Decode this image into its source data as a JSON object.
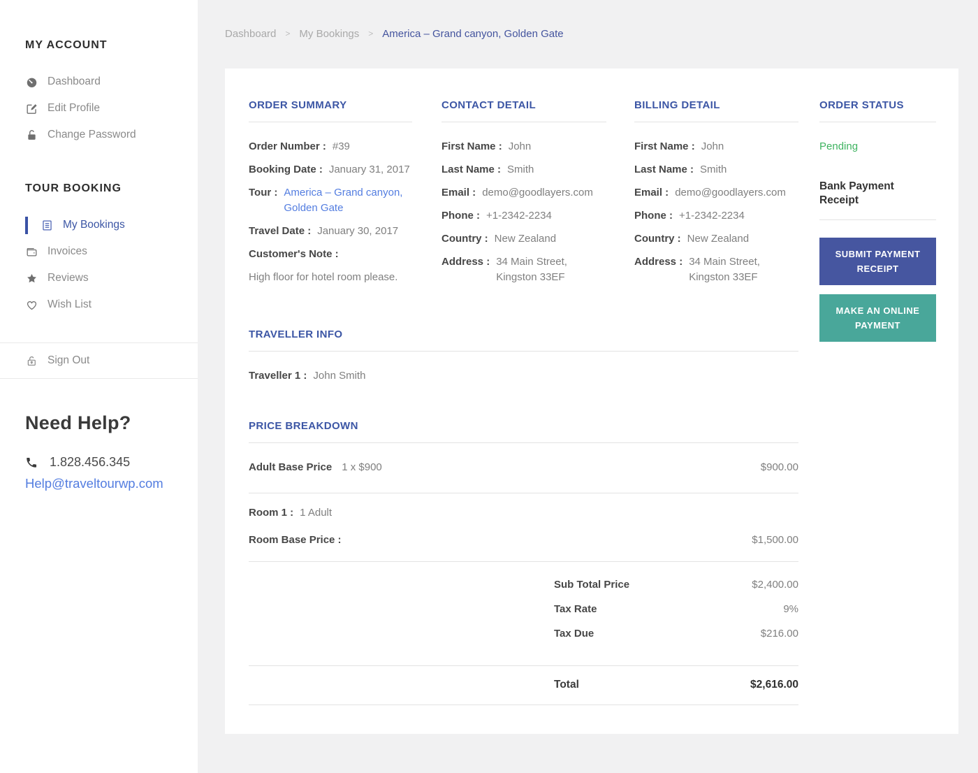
{
  "colors": {
    "heading_blue": "#3c56a5",
    "link_blue": "#537de0",
    "pending_green": "#3eb360",
    "button_blue": "#4656a0",
    "button_teal": "#49a79a",
    "background": "#f1f1f2"
  },
  "sidebar": {
    "account": {
      "title": "MY ACCOUNT",
      "items": [
        {
          "label": "Dashboard",
          "icon": "dashboard-icon"
        },
        {
          "label": "Edit Profile",
          "icon": "edit-icon"
        },
        {
          "label": "Change Password",
          "icon": "lock-icon"
        }
      ]
    },
    "booking": {
      "title": "TOUR BOOKING",
      "items": [
        {
          "label": "My Bookings",
          "icon": "bookings-icon",
          "active": true
        },
        {
          "label": "Invoices",
          "icon": "wallet-icon"
        },
        {
          "label": "Reviews",
          "icon": "star-icon"
        },
        {
          "label": "Wish List",
          "icon": "heart-icon"
        }
      ]
    },
    "signout": {
      "label": "Sign Out",
      "icon": "padlock-icon"
    },
    "help": {
      "title": "Need Help?",
      "phone": "1.828.456.345",
      "email": "Help@traveltourwp.com"
    }
  },
  "breadcrumb": {
    "sep": ">",
    "items": [
      {
        "label": "Dashboard"
      },
      {
        "label": "My Bookings"
      },
      {
        "label": "America – Grand canyon, Golden Gate"
      }
    ]
  },
  "order_summary": {
    "title": "ORDER SUMMARY",
    "rows": [
      {
        "label": "Order Number :",
        "value": "#39"
      },
      {
        "label": "Booking Date :",
        "value": "January 31, 2017"
      },
      {
        "label": "Tour :",
        "value": "America – Grand canyon, Golden Gate"
      },
      {
        "label": "Travel Date :",
        "value": "January 30, 2017"
      }
    ],
    "note_label": "Customer's Note :",
    "note": "High floor for hotel room please."
  },
  "contact_detail": {
    "title": "CONTACT DETAIL",
    "rows": [
      {
        "label": "First Name :",
        "value": "John"
      },
      {
        "label": "Last Name :",
        "value": "Smith"
      },
      {
        "label": "Email :",
        "value": "demo@goodlayers.com"
      },
      {
        "label": "Phone :",
        "value": "+1-2342-2234"
      },
      {
        "label": "Country :",
        "value": "New Zealand"
      },
      {
        "label": "Address :",
        "value": "34 Main Street, Kingston 33EF"
      }
    ]
  },
  "billing_detail": {
    "title": "BILLING DETAIL",
    "rows": [
      {
        "label": "First Name :",
        "value": "John"
      },
      {
        "label": "Last Name :",
        "value": "Smith"
      },
      {
        "label": "Email :",
        "value": "demo@goodlayers.com"
      },
      {
        "label": "Phone :",
        "value": "+1-2342-2234"
      },
      {
        "label": "Country :",
        "value": "New Zealand"
      },
      {
        "label": "Address :",
        "value": "34 Main Street, Kingston 33EF"
      }
    ]
  },
  "order_status": {
    "title": "ORDER STATUS",
    "status": "Pending",
    "receipt_label": "Bank Payment Receipt",
    "buttons": [
      {
        "label": "SUBMIT PAYMENT RECEIPT"
      },
      {
        "label": "MAKE AN ONLINE PAYMENT"
      }
    ]
  },
  "traveller_info": {
    "title": "TRAVELLER INFO",
    "row": {
      "label": "Traveller 1 :",
      "value": "John Smith"
    }
  },
  "price_breakdown": {
    "title": "PRICE BREAKDOWN",
    "items": [
      {
        "label": "Adult Base Price",
        "detail": "1 x $900",
        "amount": "$900.00"
      }
    ],
    "room": {
      "rows": [
        {
          "label": "Room 1 :",
          "value": "1 Adult"
        },
        {
          "label": "Room Base Price :",
          "amount": "$1,500.00"
        }
      ]
    },
    "totals": [
      {
        "label": "Sub Total Price",
        "value": "$2,400.00"
      },
      {
        "label": "Tax Rate",
        "value": "9%"
      },
      {
        "label": "Tax Due",
        "value": "$216.00"
      }
    ],
    "total": {
      "label": "Total",
      "value": "$2,616.00"
    }
  }
}
